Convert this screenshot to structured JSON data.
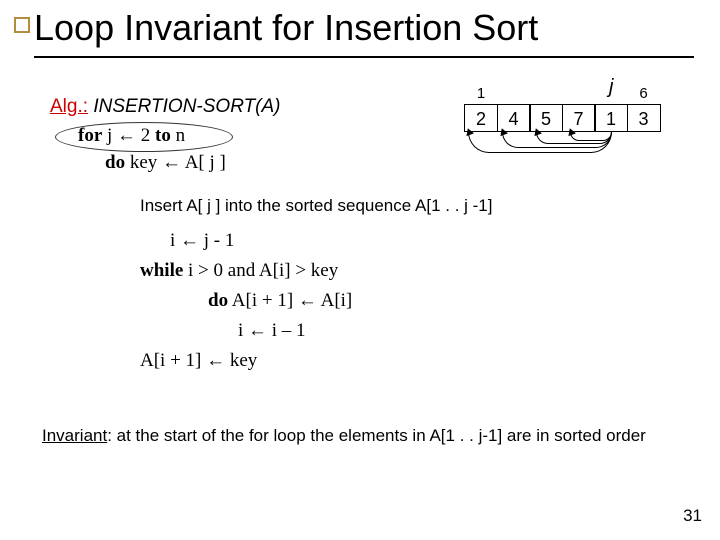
{
  "title": "Loop Invariant for Insertion Sort",
  "alg": {
    "label": "Alg.:",
    "name": "INSERTION-SORT(A)"
  },
  "code": {
    "for_kw": "for",
    "for_rest": " j ← 2 ",
    "to_kw": "to",
    "for_end": " n",
    "do_kw": "do",
    "do_rest": " key ← A[ j ]",
    "insert_note": "Insert A[ j ] into the sorted sequence A[1 . . j -1]",
    "l1": "i ← j - 1",
    "while_kw": "while",
    "l2_rest": " i > 0 and A[i] > key",
    "do2_kw": "do",
    "l3_rest": " A[i + 1] ← A[i]",
    "l4": "i ← i – 1",
    "l5": "A[i + 1] ← key"
  },
  "invariant": {
    "label": "Invariant",
    "text": ": at the start of the for loop the elements in A[1 . . j-1] are in sorted order"
  },
  "diagram": {
    "j_label": "j",
    "idx_left": "1",
    "idx_right": "6",
    "cells": [
      "2",
      "4",
      "5",
      "7",
      "1",
      "3"
    ]
  },
  "pagenum": "31"
}
